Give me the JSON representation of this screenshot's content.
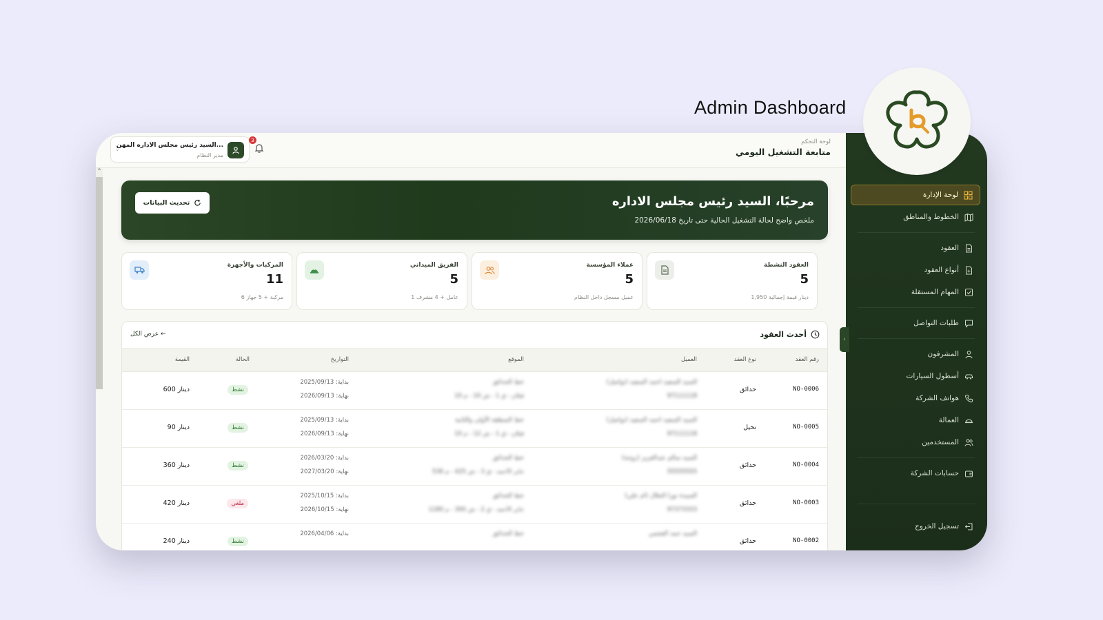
{
  "promo": {
    "title": "Admin Dashboard"
  },
  "topbar": {
    "crumb": "لوحة التحكم",
    "title": "متابعة التشغيل اليومي",
    "user_name": "السيد رئيس مجلس الاداره المهن...",
    "user_role": "مدير النظام",
    "notifications": "3"
  },
  "sidebar": {
    "items": [
      {
        "label": "لوحة الإدارة",
        "icon": "grid-icon",
        "active": true
      },
      {
        "label": "الخطوط والمناطق",
        "icon": "map-icon"
      },
      {
        "label": "العقود",
        "icon": "document-icon"
      },
      {
        "label": "أنواع العقود",
        "icon": "document-plus-icon"
      },
      {
        "label": "المهام المستقلة",
        "icon": "checkbox-icon"
      },
      {
        "label": "طلبات التواصل",
        "icon": "message-icon"
      },
      {
        "label": "المشرفون",
        "icon": "user-icon"
      },
      {
        "label": "أسطول السيارات",
        "icon": "car-icon"
      },
      {
        "label": "هواتف الشركة",
        "icon": "phone-icon"
      },
      {
        "label": "العمالة",
        "icon": "helmet-icon"
      },
      {
        "label": "المستخدمين",
        "icon": "users-icon"
      },
      {
        "label": "حسابات الشركة",
        "icon": "wallet-icon"
      }
    ],
    "logout": "تسجيل الخروج"
  },
  "hero": {
    "title": "مرحبًا، السيد رئيس مجلس الاداره",
    "subtitle": "ملخص واضح لحالة التشغيل الحالية حتى تاريخ 2026/06/18",
    "refresh": "تحديث البيانات"
  },
  "stats": [
    {
      "label": "العقود النشطة",
      "value": "5",
      "note": "1,950 دينار قيمة إجمالية",
      "icon": "document-icon",
      "color": "#6b7a63"
    },
    {
      "label": "عملاء المؤسسة",
      "value": "5",
      "note": "عميل مسجل داخل النظام",
      "icon": "users-icon",
      "color": "#e08a3c"
    },
    {
      "label": "الفريق الميداني",
      "value": "5",
      "note": "1 عامل + 4 مشرف",
      "icon": "helmet-icon",
      "color": "#3f8f4a"
    },
    {
      "label": "المركبات والأجهزة",
      "value": "11",
      "note": "6 مركبة + 5 جهاز",
      "icon": "truck-icon",
      "color": "#3d7fc4"
    }
  ],
  "table": {
    "title": "أحدث العقود",
    "view_all": "عرض الكل",
    "headers": [
      "رقم العقد",
      "نوع العقد",
      "العميل",
      "الموقع",
      "التواريخ",
      "الحالة",
      "القيمة"
    ],
    "rows": [
      {
        "id": "NO-0006",
        "type": "حدائق",
        "client": "السيد السعيد احمد السعيد (تواصل)",
        "phone": "97111118",
        "loc": "خط الحدائق",
        "addr": "قبلان - ق 1 - ش 10 - م 10",
        "start": "بداية: 2025/09/13",
        "end": "نهاية: 2026/09/13",
        "status": "نشط",
        "value": "600 دينار"
      },
      {
        "id": "NO-0005",
        "type": "نخيل",
        "client": "السيد السعيد احمد السعيد (تواصل)",
        "phone": "97111118",
        "loc": "خط المنطقة الأولى والثانية",
        "addr": "قبلان - ق 1 - ش 12 - م 10",
        "start": "بداية: 2025/09/13",
        "end": "نهاية: 2026/09/13",
        "status": "نشط",
        "value": "90 دينار"
      },
      {
        "id": "NO-0004",
        "type": "حدائق",
        "client": "السيد سالم عبدالعزيز (زوجة)",
        "phone": "55555555",
        "loc": "خط الحدائق",
        "addr": "جابر الأحمد - ق 3 - ش 425 - م 536",
        "start": "بداية: 2026/03/20",
        "end": "نهاية: 2027/03/20",
        "status": "نشط",
        "value": "360 دينار"
      },
      {
        "id": "NO-0003",
        "type": "حدائق",
        "client": "السيدة نورا الجلال (ام علي)",
        "phone": "97373333",
        "loc": "خط الحدائق",
        "addr": "جابر الأحمد - ق 2 - ش 300 - م 1180",
        "start": "بداية: 2025/10/15",
        "end": "نهاية: 2026/10/15",
        "status": "ملغي",
        "value": "420 دينار"
      },
      {
        "id": "NO-0002",
        "type": "حدائق",
        "client": "السيد حمد العجمي",
        "phone": "",
        "loc": "خط الحدائق",
        "addr": "",
        "start": "بداية: 2026/04/06",
        "end": "",
        "status": "نشط",
        "value": "240 دينار"
      }
    ]
  },
  "colors": {
    "sidebar": "#22381f",
    "hero": "#2b4626",
    "accent": "#e59b2a",
    "active_item": "#4d4a21"
  }
}
